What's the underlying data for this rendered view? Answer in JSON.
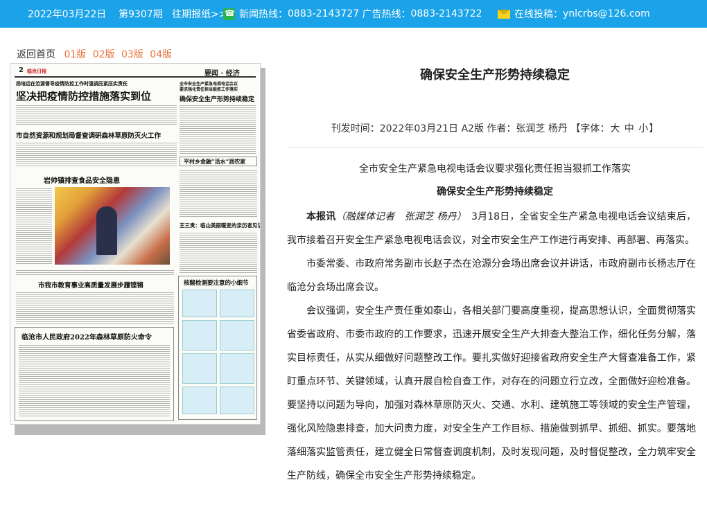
{
  "topbar": {
    "date": "2022年03月22日",
    "issue": "第9307期",
    "past_link": "往期报纸>>",
    "hotline_label": "新闻热线：",
    "hotline_number": "0883-2143727",
    "ad_label": "广告热线：",
    "ad_number": "0883-2143722",
    "submit_label": "在线投稿：",
    "submit_email": "ynlcrbs@126.com",
    "phone_icon": "phone-icon",
    "mail_icon": "envelope-icon"
  },
  "pagenav": {
    "home": "返回首页",
    "versions": [
      "01版",
      "02版",
      "03版",
      "04版"
    ]
  },
  "paper": {
    "page_no": "2",
    "masthead": "临沧日报",
    "column": "要闻 · 经济",
    "headlines": {
      "kicker1": "扬培远在沧源督导疫情防控工作时强调压紧压实责任",
      "main1": "坚决把疫情防控措施落实到位",
      "kicker_right": "全市安全生产紧急电视电话会议",
      "kicker_right2": "要求强化责任担当狠抓工作落实",
      "main_right": "确保安全生产形势持续稳定",
      "h2": "市自然资源和规划局督查调研森林草原防灭火工作",
      "h3": "平村乡金融“活水”润农家",
      "h4": "岩帅镇排查食品安全隐患",
      "h5": "王三贵：临山美丽暖变的亲历者见证者",
      "h6": "市我市教育事业高质量发展步履铿锵",
      "h7": "核酸检测要注意的小细节",
      "h8": "临沧市人民政府2022年森林草原防火命令"
    }
  },
  "article": {
    "title": "确保安全生产形势持续稳定",
    "meta_prefix": "刊发时间：",
    "publish_date": "2022年03月21日",
    "edition": "A2版",
    "author_label": "作者：",
    "authors": "张润芝 杨丹",
    "font_label": "【字体：",
    "font_sizes": [
      "大",
      "中",
      "小"
    ],
    "font_close": "】",
    "subhead": "全市安全生产紧急电视电话会议要求强化责任担当狠抓工作落实",
    "subtitle": "确保安全生产形势持续稳定",
    "lead_bold": "本报讯",
    "lead_reporter": "（融媒体记者　张润芝 杨丹）",
    "p1": "3月18日，全省安全生产紧急电视电话会议结束后，我市接着召开安全生产紧急电视电话会议，对全市安全生产工作进行再安排、再部署、再落实。",
    "p2": "市委常委、市政府常务副市长赵子杰在沧源分会场出席会议并讲话，市政府副市长杨志厅在临沧分会场出席会议。",
    "p3": "会议强调，安全生产责任重如泰山，各相关部门要高度重视，提高思想认识，全面贯彻落实省委省政府、市委市政府的工作要求，迅速开展安全生产大排查大整治工作，细化任务分解，落实目标责任，从实从细做好问题整改工作。要扎实做好迎接省政府安全生产大督查准备工作，紧盯重点环节、关键领域，认真开展自检自查工作，对存在的问题立行立改，全面做好迎检准备。要坚持以问题为导向，加强对森林草原防灭火、交通、水利、建筑施工等领域的安全生产管理，强化风险隐患排查，加大问责力度，对安全生产工作目标、措施做到抓早、抓细、抓实。要落地落细落实监管责任，建立健全日常督查调度机制，及时发现问题，及时督促整改，全力筑牢安全生产防线，确保全市安全生产形势持续稳定。"
  },
  "colors": {
    "topbar": "#1aa3e8",
    "version_link": "#e8743b"
  }
}
